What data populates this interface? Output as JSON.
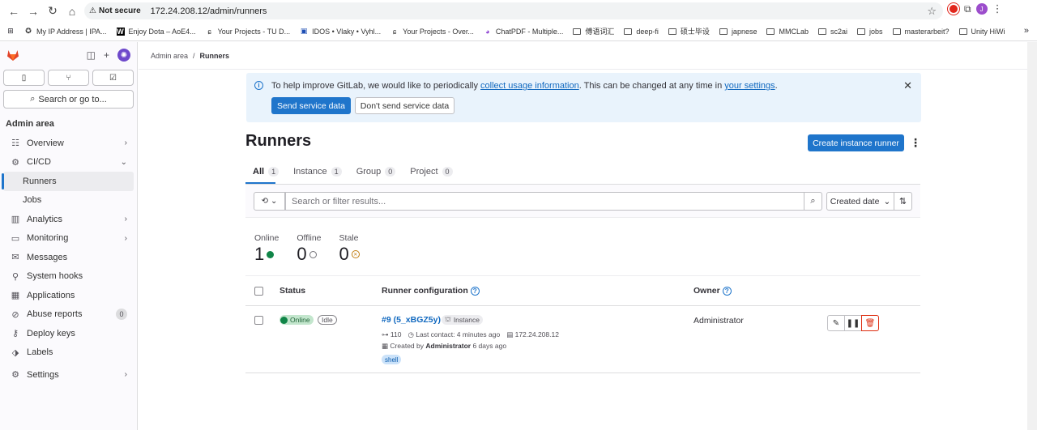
{
  "browser": {
    "not_secure": "Not secure",
    "url": "172.24.208.12/admin/runners",
    "profile_initial": "J",
    "bookmarks": [
      {
        "icon": "ip-icon",
        "label": "My IP Address | IPA..."
      },
      {
        "icon": "w-icon",
        "label": "Enjoy Dota – AoE4..."
      },
      {
        "icon": "project-icon",
        "label": "Your Projects - TU D..."
      },
      {
        "icon": "idos-icon",
        "label": "IDOS • Vlaky • Vyhl..."
      },
      {
        "icon": "project-icon",
        "label": "Your Projects - Over..."
      },
      {
        "icon": "chatpdf-icon",
        "label": "ChatPDF - Multiple..."
      },
      {
        "icon": "folder-icon",
        "label": "傅语词汇"
      },
      {
        "icon": "folder-icon",
        "label": "deep-fi"
      },
      {
        "icon": "folder-icon",
        "label": "硕士毕设"
      },
      {
        "icon": "folder-icon",
        "label": "japnese"
      },
      {
        "icon": "folder-icon",
        "label": "MMCLab"
      },
      {
        "icon": "folder-icon",
        "label": "sc2ai"
      },
      {
        "icon": "folder-icon",
        "label": "jobs"
      },
      {
        "icon": "folder-icon",
        "label": "masterarbeit?"
      },
      {
        "icon": "folder-icon",
        "label": "Unity HiWi"
      }
    ]
  },
  "sidebar": {
    "search_label": "Search or go to...",
    "section_title": "Admin area",
    "items": [
      {
        "name": "overview",
        "icon": "☷",
        "label": "Overview",
        "chevron": "›"
      },
      {
        "name": "cicd",
        "icon": "⚙",
        "label": "CI/CD",
        "chevron": "⌄"
      },
      {
        "name": "runners",
        "label": "Runners"
      },
      {
        "name": "jobs",
        "label": "Jobs"
      },
      {
        "name": "analytics",
        "icon": "▥",
        "label": "Analytics",
        "chevron": "›"
      },
      {
        "name": "monitoring",
        "icon": "▭",
        "label": "Monitoring",
        "chevron": "›"
      },
      {
        "name": "messages",
        "icon": "✉",
        "label": "Messages"
      },
      {
        "name": "system-hooks",
        "icon": "⚲",
        "label": "System hooks"
      },
      {
        "name": "applications",
        "icon": "▦",
        "label": "Applications"
      },
      {
        "name": "abuse-reports",
        "icon": "⊘",
        "label": "Abuse reports",
        "count": "0"
      },
      {
        "name": "deploy-keys",
        "icon": "⚷",
        "label": "Deploy keys"
      },
      {
        "name": "labels",
        "icon": "⬗",
        "label": "Labels"
      },
      {
        "name": "settings",
        "icon": "⚙",
        "label": "Settings",
        "chevron": "›"
      }
    ]
  },
  "breadcrumb": {
    "root": "Admin area",
    "sep": "/",
    "current": "Runners"
  },
  "alert": {
    "text_pre": "To help improve GitLab, we would like to periodically ",
    "link1": "collect usage information",
    "text_mid": ". This can be changed at any time in ",
    "link2": "your settings",
    "text_post": ".",
    "primary": "Send service data",
    "secondary": "Don't send service data"
  },
  "page": {
    "title": "Runners",
    "create_button": "Create instance runner"
  },
  "tabs": [
    {
      "label": "All",
      "count": "1"
    },
    {
      "label": "Instance",
      "count": "1"
    },
    {
      "label": "Group",
      "count": "0"
    },
    {
      "label": "Project",
      "count": "0"
    }
  ],
  "filter": {
    "placeholder": "Search or filter results...",
    "sort_label": "Created date"
  },
  "stats": {
    "online_label": "Online",
    "online_value": "1",
    "offline_label": "Offline",
    "offline_value": "0",
    "stale_label": "Stale",
    "stale_value": "0"
  },
  "table": {
    "headers": {
      "status": "Status",
      "config": "Runner configuration",
      "owner": "Owner"
    },
    "row": {
      "status": "Online",
      "state": "Idle",
      "runner": "#9 (5_xBGZ5y)",
      "type": "Instance",
      "jobs": "110",
      "last_contact": "Last contact: 4 minutes ago",
      "ip": "172.24.208.12",
      "created_pre": "Created by ",
      "created_by": "Administrator",
      "created_post": " 6 days ago",
      "tag": "shell",
      "owner": "Administrator"
    }
  },
  "colors": {
    "primary": "#1f75cb",
    "online": "#108548",
    "danger": "#dd2b0e"
  }
}
